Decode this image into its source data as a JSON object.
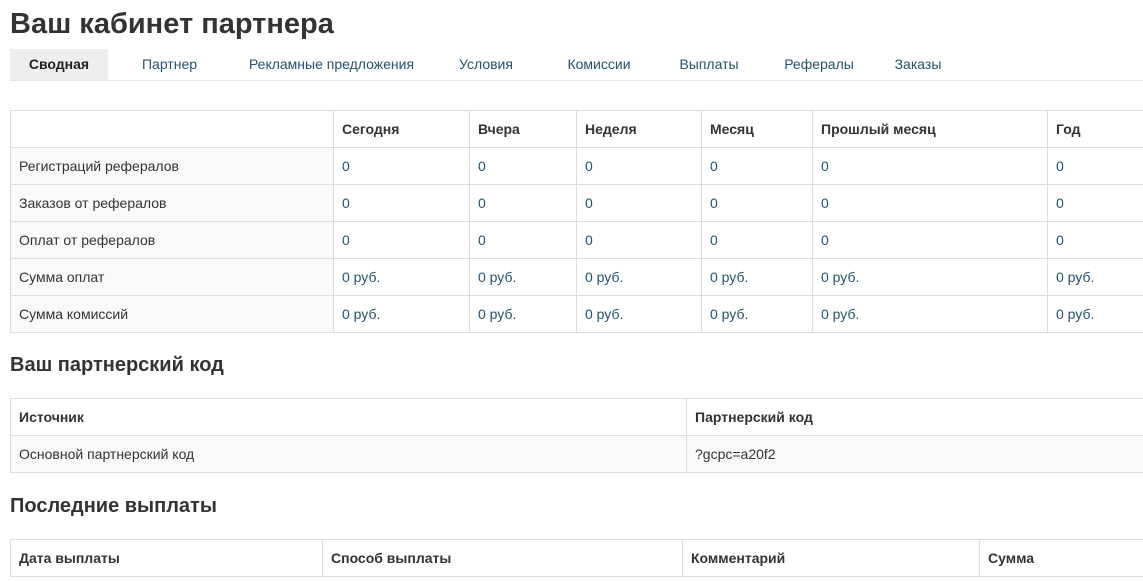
{
  "page": {
    "title": "Ваш кабинет партнера"
  },
  "tabs": [
    {
      "label": "Сводная",
      "active": true
    },
    {
      "label": "Партнер",
      "active": false
    },
    {
      "label": "Рекламные предложения",
      "active": false
    },
    {
      "label": "Условия",
      "active": false
    },
    {
      "label": "Комиссии",
      "active": false
    },
    {
      "label": "Выплаты",
      "active": false
    },
    {
      "label": "Рефералы",
      "active": false
    },
    {
      "label": "Заказы",
      "active": false
    }
  ],
  "stats": {
    "headers": [
      "",
      "Сегодня",
      "Вчера",
      "Неделя",
      "Месяц",
      "Прошлый месяц",
      "Год"
    ],
    "rows": [
      {
        "label": "Регистраций рефералов",
        "values": [
          "0",
          "0",
          "0",
          "0",
          "0",
          "0"
        ]
      },
      {
        "label": "Заказов от рефералов",
        "values": [
          "0",
          "0",
          "0",
          "0",
          "0",
          "0"
        ]
      },
      {
        "label": "Оплат от рефералов",
        "values": [
          "0",
          "0",
          "0",
          "0",
          "0",
          "0"
        ]
      },
      {
        "label": "Сумма оплат",
        "values": [
          "0 руб.",
          "0 руб.",
          "0 руб.",
          "0 руб.",
          "0 руб.",
          "0 руб."
        ]
      },
      {
        "label": "Сумма комиссий",
        "values": [
          "0 руб.",
          "0 руб.",
          "0 руб.",
          "0 руб.",
          "0 руб.",
          "0 руб."
        ]
      }
    ]
  },
  "partner_code": {
    "title": "Ваш партнерский код",
    "headers": [
      "Источник",
      "Партнерский код"
    ],
    "rows": [
      {
        "source": "Основной партнерский код",
        "code": "?gcpc=a20f2"
      }
    ]
  },
  "payouts": {
    "title": "Последние выплаты",
    "headers": [
      "Дата выплаты",
      "Способ выплаты",
      "Комментарий",
      "Сумма"
    ]
  }
}
